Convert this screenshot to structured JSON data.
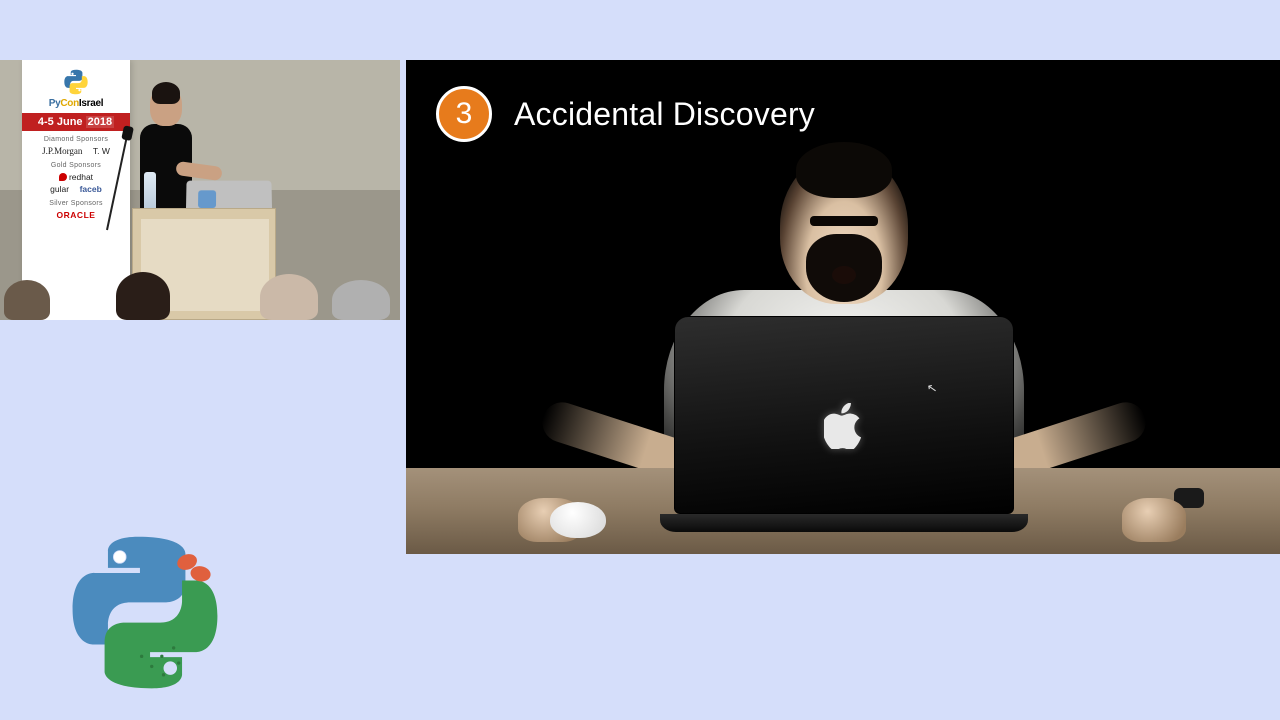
{
  "conference": {
    "name_py": "Py",
    "name_con": "Con",
    "name_rest": "Israel",
    "date_prefix": "4-5 June ",
    "date_year": "2018",
    "tiers": {
      "diamond": "Diamond Sponsors",
      "gold": "Gold Sponsors",
      "silver": "Silver Sponsors"
    },
    "sponsors": {
      "jpmorgan": "J.P.Morgan",
      "tw": "T. W",
      "redhat": "redhat",
      "gular": "gular",
      "facebook": "faceb",
      "oracle": "ORACLE"
    }
  },
  "slide": {
    "number": "3",
    "title": "Accidental Discovery"
  },
  "icons": {
    "apple": "apple-logo",
    "python": "python-cactus-logo",
    "cursor": "↖"
  }
}
